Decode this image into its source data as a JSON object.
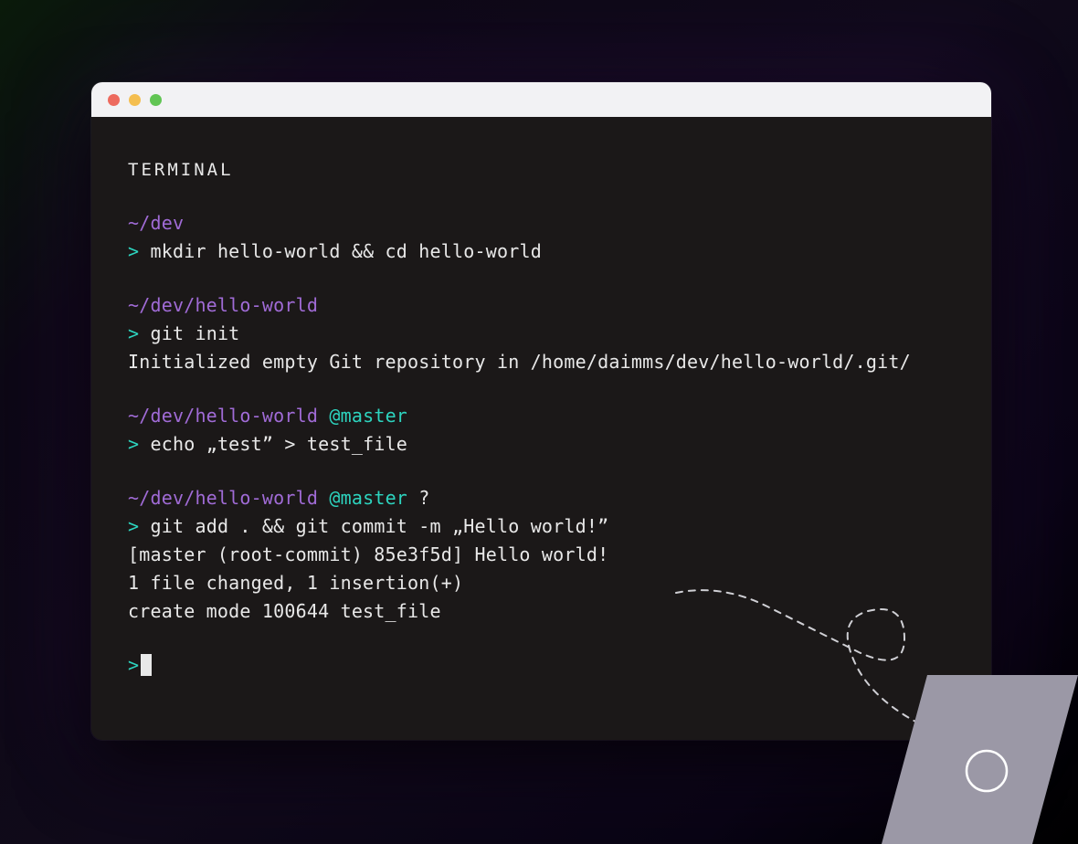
{
  "titlebar": {
    "dots": [
      "close",
      "minimize",
      "zoom"
    ]
  },
  "terminal": {
    "label": "TERMINAL",
    "blocks": [
      {
        "path": "~/dev",
        "branch": "",
        "status": "",
        "command": "mkdir hello-world && cd hello-world",
        "output": []
      },
      {
        "path": "~/dev/hello-world",
        "branch": "",
        "status": "",
        "command": "git init",
        "output": [
          "Initialized empty Git repository in /home/daimms/dev/hello-world/.git/"
        ]
      },
      {
        "path": "~/dev/hello-world",
        "branch": "@master",
        "status": "",
        "command": "echo „test” > test_file",
        "output": []
      },
      {
        "path": "~/dev/hello-world",
        "branch": "@master",
        "status": "?",
        "command": "git add . && git commit -m „Hello world!”",
        "output": [
          "[master (root-commit) 85e3f5d] Hello world!",
          "1 file changed, 1 insertion(+)",
          "create mode 100644 test_file"
        ]
      }
    ],
    "prompt_char": ">",
    "cursor": true
  },
  "colors": {
    "path": "#a06bd6",
    "branch": "#2dd4bf",
    "prompt": "#2dd4bf",
    "text": "#e8e8e8",
    "window_bg": "#1b1818",
    "titlebar_bg": "#f2f2f4"
  }
}
